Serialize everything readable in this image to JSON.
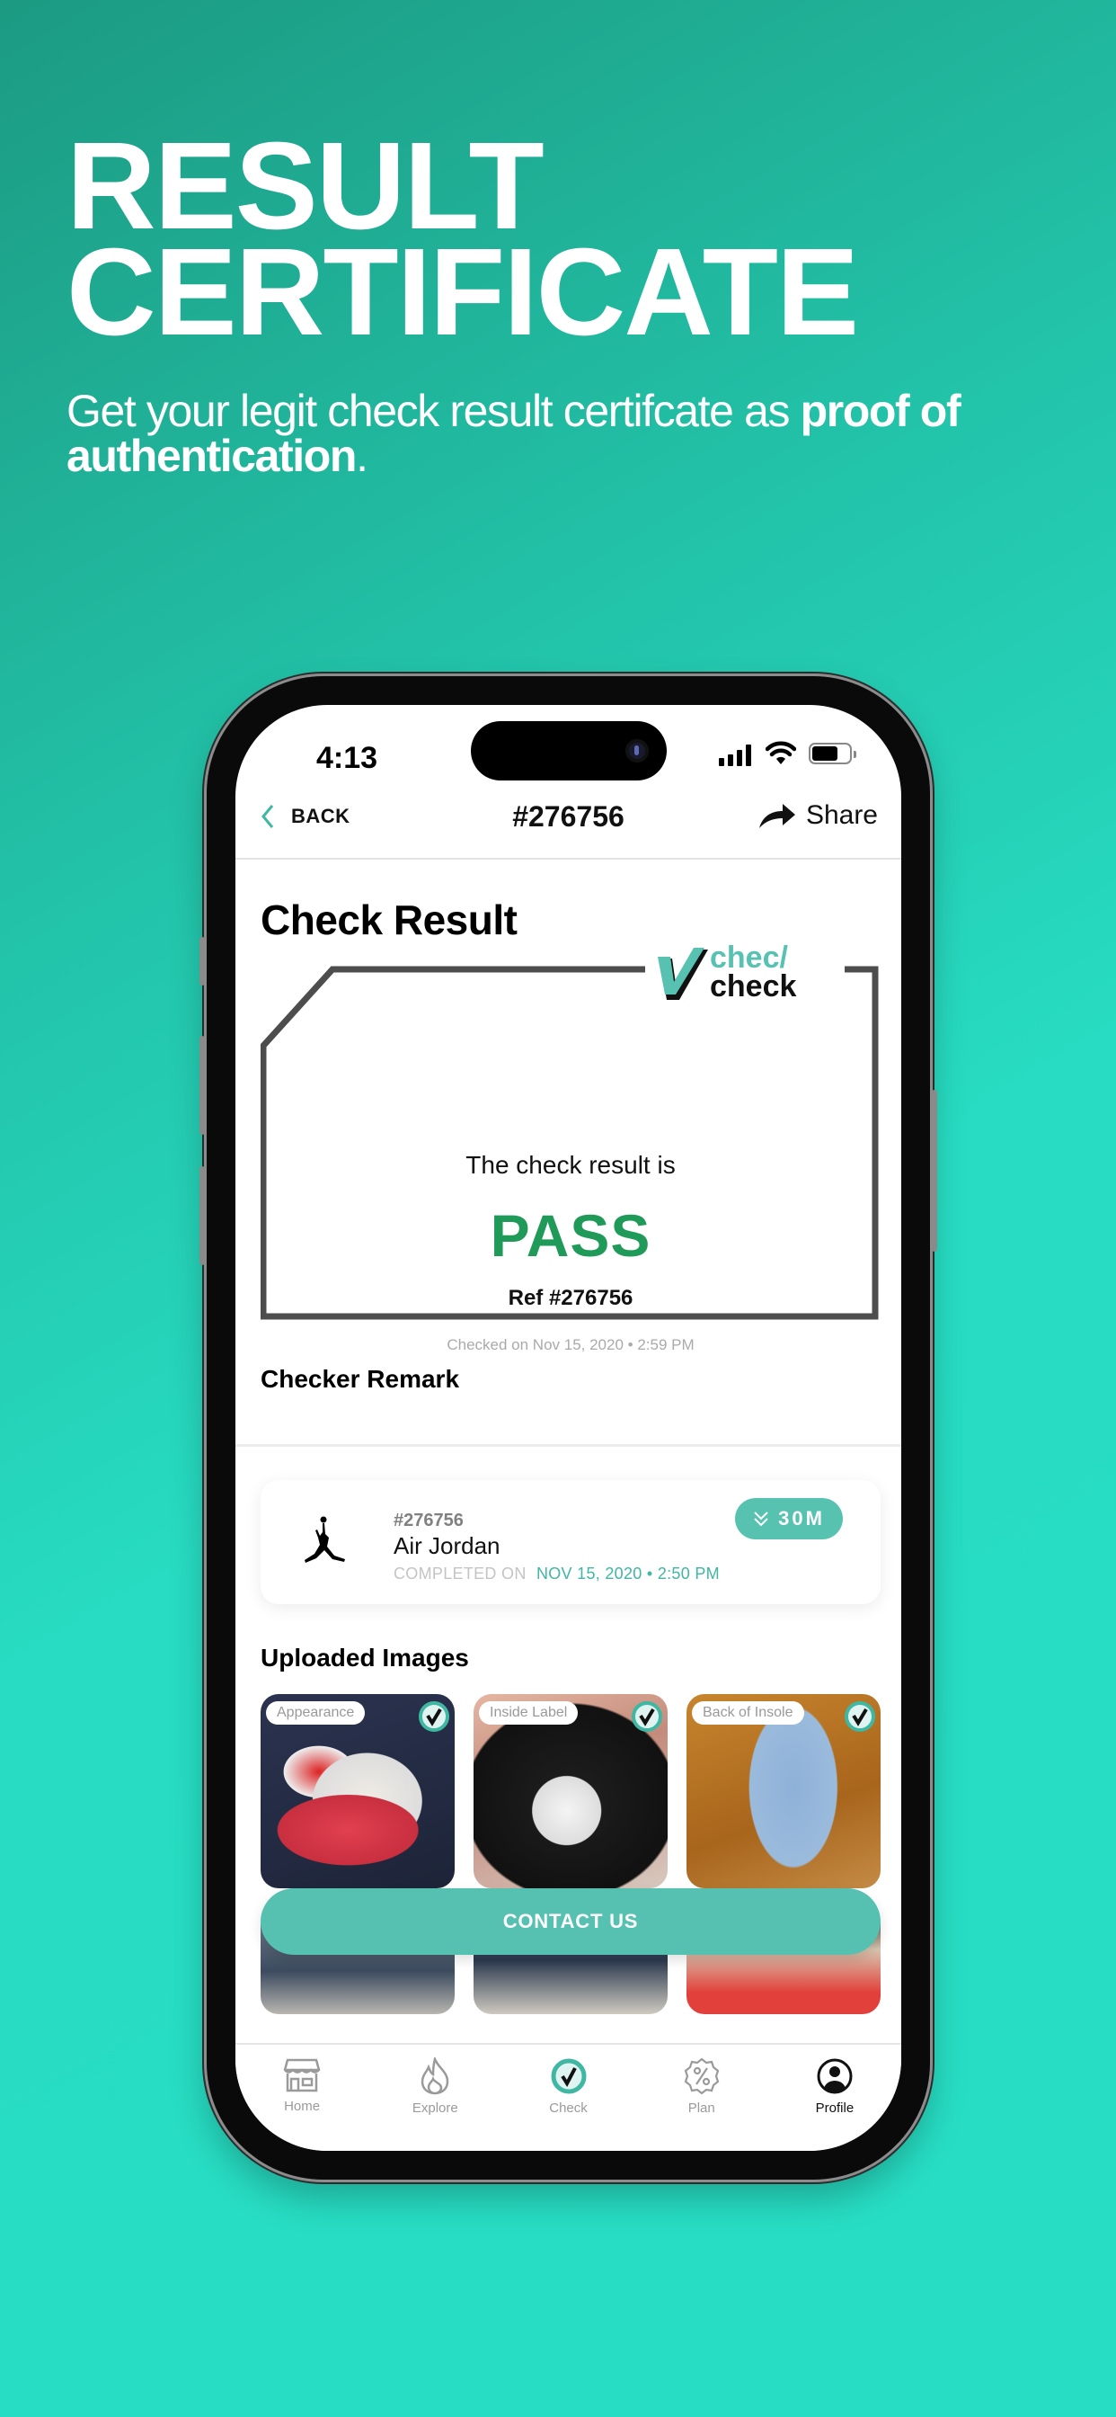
{
  "hero": {
    "title_line1": "RESULT",
    "title_line2": "CERTIFICATE",
    "subtitle_plain": "Get your legit check result certifcate as ",
    "subtitle_bold": "proof of authentication",
    "subtitle_end": "."
  },
  "status_bar": {
    "time": "4:13",
    "icons": [
      "signal-icon",
      "wifi-icon",
      "battery-icon"
    ]
  },
  "nav": {
    "back_label": "BACK",
    "title": "#276756",
    "share_label": "Share"
  },
  "certificate": {
    "heading": "Check Result",
    "logo_line1": "check",
    "logo_line2": "check",
    "intro": "The check result is",
    "result": "PASS",
    "ref": "Ref #276756",
    "checked_on": "Checked on Nov 15, 2020 • 2:59 PM"
  },
  "remark": {
    "heading": "Checker Remark",
    "text": ""
  },
  "order_card": {
    "id": "#276756",
    "brand": "Air Jordan",
    "completed_label": "COMPLETED ON",
    "completed_value": "NOV 15, 2020 • 2:50 PM",
    "badge": "30M"
  },
  "uploaded": {
    "heading": "Uploaded Images",
    "images": [
      {
        "label": "Appearance",
        "verified": true
      },
      {
        "label": "Inside Label",
        "verified": true
      },
      {
        "label": "Back of Insole",
        "verified": true
      }
    ]
  },
  "contact_button": "CONTACT US",
  "tabbar": {
    "items": [
      {
        "label": "Home",
        "icon": "store-icon",
        "active": false
      },
      {
        "label": "Explore",
        "icon": "flame-icon",
        "active": false
      },
      {
        "label": "Check",
        "icon": "check-badge-icon",
        "active": false
      },
      {
        "label": "Plan",
        "icon": "percent-badge-icon",
        "active": false
      },
      {
        "label": "Profile",
        "icon": "profile-icon",
        "active": true
      }
    ]
  },
  "colors": {
    "accent": "#56c1b0",
    "pass_green": "#1f9a59",
    "date_teal": "#3fb7a3",
    "bg_gradient_start": "#1c9a82",
    "bg_gradient_end": "#27dec4"
  }
}
